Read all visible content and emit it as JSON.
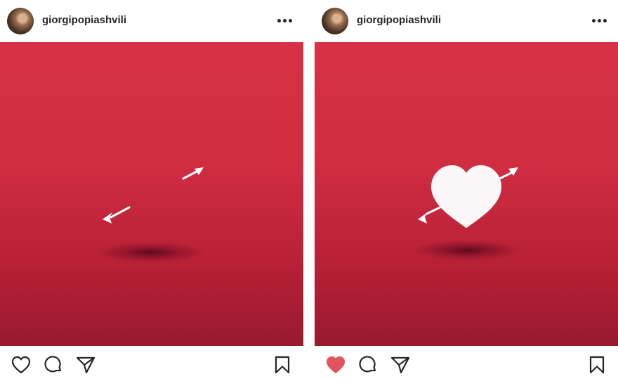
{
  "posts": [
    {
      "username": "giorgipopiashvili",
      "liked": false,
      "heart_visible": false
    },
    {
      "username": "giorgipopiashvili",
      "liked": true,
      "heart_visible": true
    }
  ],
  "icons": {
    "more": "more-options-icon",
    "like": "heart-icon",
    "comment": "comment-icon",
    "share": "paper-plane-icon",
    "save": "bookmark-icon"
  },
  "colors": {
    "image_top": "#d63144",
    "image_bottom": "#981a2f",
    "liked_heart": "#e0555f",
    "text": "#262626"
  }
}
